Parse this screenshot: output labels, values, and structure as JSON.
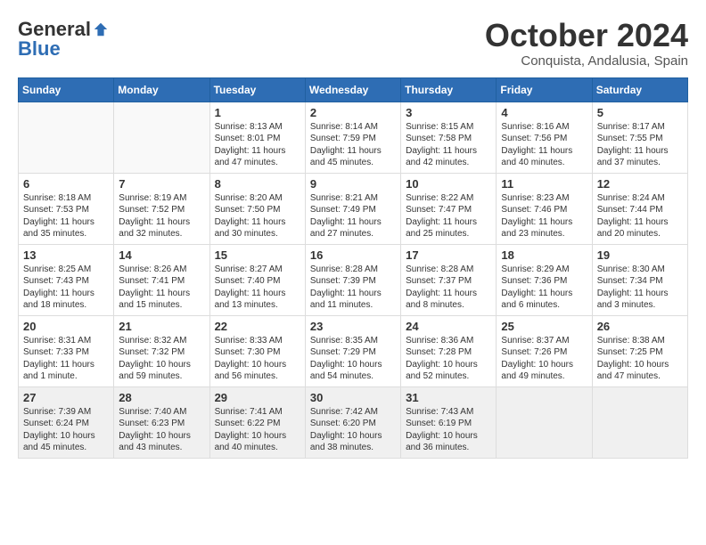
{
  "logo": {
    "general": "General",
    "blue": "Blue"
  },
  "title": "October 2024",
  "location": "Conquista, Andalusia, Spain",
  "weekdays": [
    "Sunday",
    "Monday",
    "Tuesday",
    "Wednesday",
    "Thursday",
    "Friday",
    "Saturday"
  ],
  "weeks": [
    [
      {
        "day": "",
        "info": ""
      },
      {
        "day": "",
        "info": ""
      },
      {
        "day": "1",
        "info": "Sunrise: 8:13 AM\nSunset: 8:01 PM\nDaylight: 11 hours and 47 minutes."
      },
      {
        "day": "2",
        "info": "Sunrise: 8:14 AM\nSunset: 7:59 PM\nDaylight: 11 hours and 45 minutes."
      },
      {
        "day": "3",
        "info": "Sunrise: 8:15 AM\nSunset: 7:58 PM\nDaylight: 11 hours and 42 minutes."
      },
      {
        "day": "4",
        "info": "Sunrise: 8:16 AM\nSunset: 7:56 PM\nDaylight: 11 hours and 40 minutes."
      },
      {
        "day": "5",
        "info": "Sunrise: 8:17 AM\nSunset: 7:55 PM\nDaylight: 11 hours and 37 minutes."
      }
    ],
    [
      {
        "day": "6",
        "info": "Sunrise: 8:18 AM\nSunset: 7:53 PM\nDaylight: 11 hours and 35 minutes."
      },
      {
        "day": "7",
        "info": "Sunrise: 8:19 AM\nSunset: 7:52 PM\nDaylight: 11 hours and 32 minutes."
      },
      {
        "day": "8",
        "info": "Sunrise: 8:20 AM\nSunset: 7:50 PM\nDaylight: 11 hours and 30 minutes."
      },
      {
        "day": "9",
        "info": "Sunrise: 8:21 AM\nSunset: 7:49 PM\nDaylight: 11 hours and 27 minutes."
      },
      {
        "day": "10",
        "info": "Sunrise: 8:22 AM\nSunset: 7:47 PM\nDaylight: 11 hours and 25 minutes."
      },
      {
        "day": "11",
        "info": "Sunrise: 8:23 AM\nSunset: 7:46 PM\nDaylight: 11 hours and 23 minutes."
      },
      {
        "day": "12",
        "info": "Sunrise: 8:24 AM\nSunset: 7:44 PM\nDaylight: 11 hours and 20 minutes."
      }
    ],
    [
      {
        "day": "13",
        "info": "Sunrise: 8:25 AM\nSunset: 7:43 PM\nDaylight: 11 hours and 18 minutes."
      },
      {
        "day": "14",
        "info": "Sunrise: 8:26 AM\nSunset: 7:41 PM\nDaylight: 11 hours and 15 minutes."
      },
      {
        "day": "15",
        "info": "Sunrise: 8:27 AM\nSunset: 7:40 PM\nDaylight: 11 hours and 13 minutes."
      },
      {
        "day": "16",
        "info": "Sunrise: 8:28 AM\nSunset: 7:39 PM\nDaylight: 11 hours and 11 minutes."
      },
      {
        "day": "17",
        "info": "Sunrise: 8:28 AM\nSunset: 7:37 PM\nDaylight: 11 hours and 8 minutes."
      },
      {
        "day": "18",
        "info": "Sunrise: 8:29 AM\nSunset: 7:36 PM\nDaylight: 11 hours and 6 minutes."
      },
      {
        "day": "19",
        "info": "Sunrise: 8:30 AM\nSunset: 7:34 PM\nDaylight: 11 hours and 3 minutes."
      }
    ],
    [
      {
        "day": "20",
        "info": "Sunrise: 8:31 AM\nSunset: 7:33 PM\nDaylight: 11 hours and 1 minute."
      },
      {
        "day": "21",
        "info": "Sunrise: 8:32 AM\nSunset: 7:32 PM\nDaylight: 10 hours and 59 minutes."
      },
      {
        "day": "22",
        "info": "Sunrise: 8:33 AM\nSunset: 7:30 PM\nDaylight: 10 hours and 56 minutes."
      },
      {
        "day": "23",
        "info": "Sunrise: 8:35 AM\nSunset: 7:29 PM\nDaylight: 10 hours and 54 minutes."
      },
      {
        "day": "24",
        "info": "Sunrise: 8:36 AM\nSunset: 7:28 PM\nDaylight: 10 hours and 52 minutes."
      },
      {
        "day": "25",
        "info": "Sunrise: 8:37 AM\nSunset: 7:26 PM\nDaylight: 10 hours and 49 minutes."
      },
      {
        "day": "26",
        "info": "Sunrise: 8:38 AM\nSunset: 7:25 PM\nDaylight: 10 hours and 47 minutes."
      }
    ],
    [
      {
        "day": "27",
        "info": "Sunrise: 7:39 AM\nSunset: 6:24 PM\nDaylight: 10 hours and 45 minutes."
      },
      {
        "day": "28",
        "info": "Sunrise: 7:40 AM\nSunset: 6:23 PM\nDaylight: 10 hours and 43 minutes."
      },
      {
        "day": "29",
        "info": "Sunrise: 7:41 AM\nSunset: 6:22 PM\nDaylight: 10 hours and 40 minutes."
      },
      {
        "day": "30",
        "info": "Sunrise: 7:42 AM\nSunset: 6:20 PM\nDaylight: 10 hours and 38 minutes."
      },
      {
        "day": "31",
        "info": "Sunrise: 7:43 AM\nSunset: 6:19 PM\nDaylight: 10 hours and 36 minutes."
      },
      {
        "day": "",
        "info": ""
      },
      {
        "day": "",
        "info": ""
      }
    ]
  ]
}
